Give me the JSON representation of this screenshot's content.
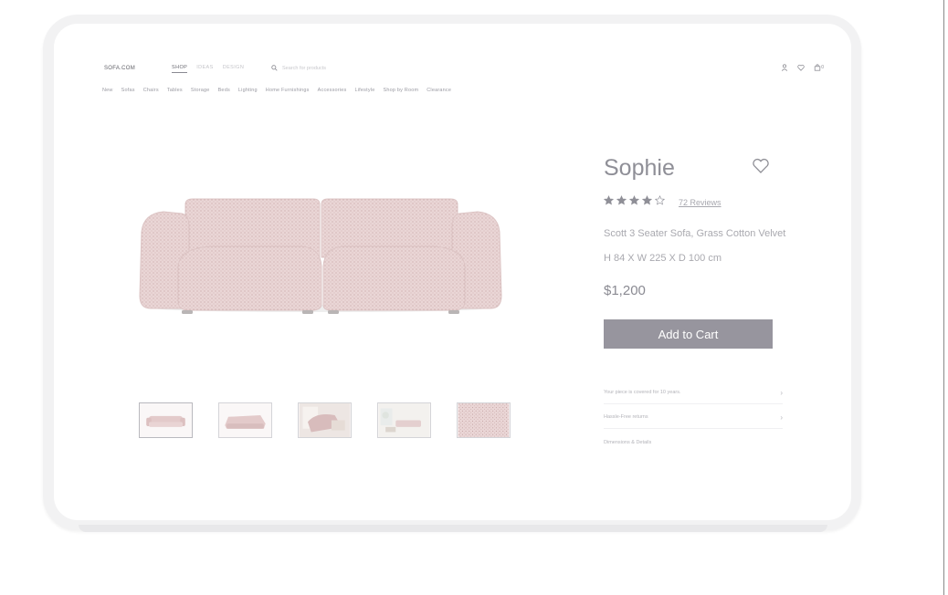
{
  "header": {
    "logo": "SOFA.COM",
    "modes": [
      "SHOP",
      "IDEAS",
      "DESIGN"
    ],
    "search_placeholder": "Search for products",
    "cart_count": "0"
  },
  "categories": [
    "New",
    "Sofas",
    "Chairs",
    "Tables",
    "Storage",
    "Beds",
    "Lighting",
    "Home Furnishings",
    "Accessories",
    "Lifestyle",
    "Shop by Room",
    "Clearance"
  ],
  "product": {
    "name": "Sophie",
    "rating": 4,
    "rating_max": 5,
    "reviews_label": "72 Reviews",
    "subtitle": "Scott 3 Seater Sofa, Grass Cotton Velvet",
    "dimensions": "H 84 X W 225 X D 100 cm",
    "price": "$1,200",
    "add_to_cart": "Add to Cart"
  },
  "info_rows": [
    {
      "label": "Your piece is covered for 10 years.",
      "chevron": true
    },
    {
      "label": "Hassle-Free returns",
      "chevron": true
    },
    {
      "label": "Dimensions & Details",
      "chevron": false
    }
  ],
  "thumbnails": [
    "front",
    "back",
    "lifestyle-room",
    "lifestyle-living",
    "fabric-swatch"
  ],
  "colors": {
    "accent_button": "#97959e",
    "sofa": "#e8d2d2"
  }
}
